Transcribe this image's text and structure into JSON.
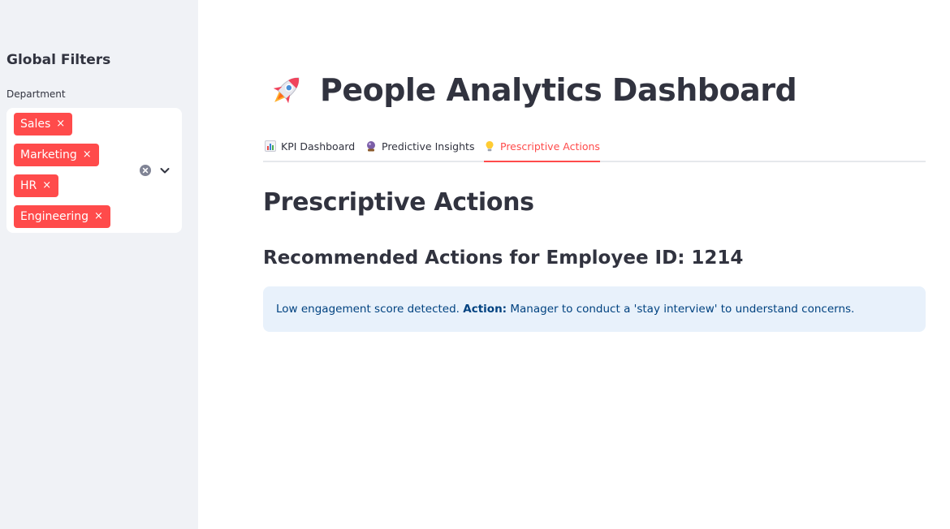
{
  "sidebar": {
    "title": "Global Filters",
    "department": {
      "label": "Department",
      "selected": [
        "Sales",
        "Marketing",
        "HR",
        "Engineering"
      ],
      "remove_glyph": "×"
    },
    "icons": [
      "clear-icon",
      "chevron-down-icon"
    ]
  },
  "header": {
    "icon": "rocket-icon",
    "title": "People Analytics Dashboard"
  },
  "tabs": [
    {
      "label": "KPI Dashboard",
      "icon": "bar-chart-icon",
      "active": false
    },
    {
      "label": "Predictive Insights",
      "icon": "crystal-ball-icon",
      "active": false
    },
    {
      "label": "Prescriptive Actions",
      "icon": "lightbulb-icon",
      "active": true
    }
  ],
  "main": {
    "heading": "Prescriptive Actions",
    "subheading": "Recommended Actions for Employee ID: 1214",
    "info": {
      "lead": "Low engagement score detected. ",
      "action_label": "Action:",
      "action_text": " Manager to conduct a 'stay interview' to understand concerns."
    }
  },
  "colors": {
    "accent": "#ff4b4b",
    "sidebar_bg": "#f0f2f6",
    "info_bg": "#e8f1fb",
    "info_text": "#004280",
    "text": "#31333f"
  }
}
